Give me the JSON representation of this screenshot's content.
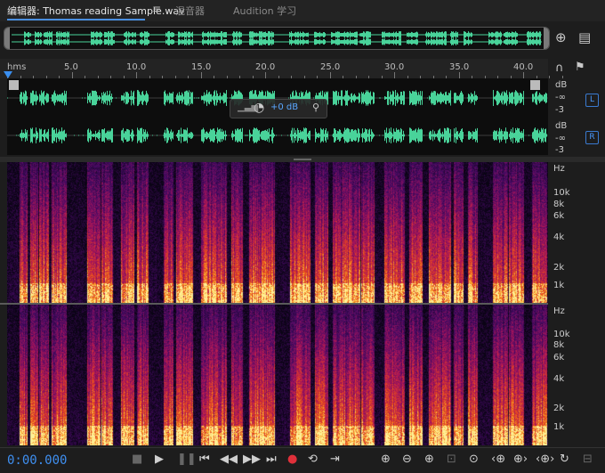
{
  "tabs": {
    "editor": "编辑器: Thomas reading Sample.wav",
    "mixer": "混音器",
    "learn": "Audition 学习"
  },
  "ruler": {
    "labels": [
      "hms",
      "5.0",
      "10.0",
      "15.0",
      "20.0",
      "25.0",
      "30.0",
      "35.0",
      "40.0"
    ]
  },
  "waveform": {
    "db_unit": "dB",
    "db_inf": "-∞",
    "db_minus3": "-3",
    "channel_left": "L",
    "channel_right": "R",
    "volume_display": "+0 dB"
  },
  "spectrogram": {
    "unit": "Hz",
    "labels": [
      "10k",
      "8k",
      "6k",
      "4k",
      "2k",
      "1k"
    ]
  },
  "transport": {
    "timecode": "0:00.000"
  },
  "colors": {
    "accent": "#3f8ff0",
    "waveform": "#49d39a"
  }
}
